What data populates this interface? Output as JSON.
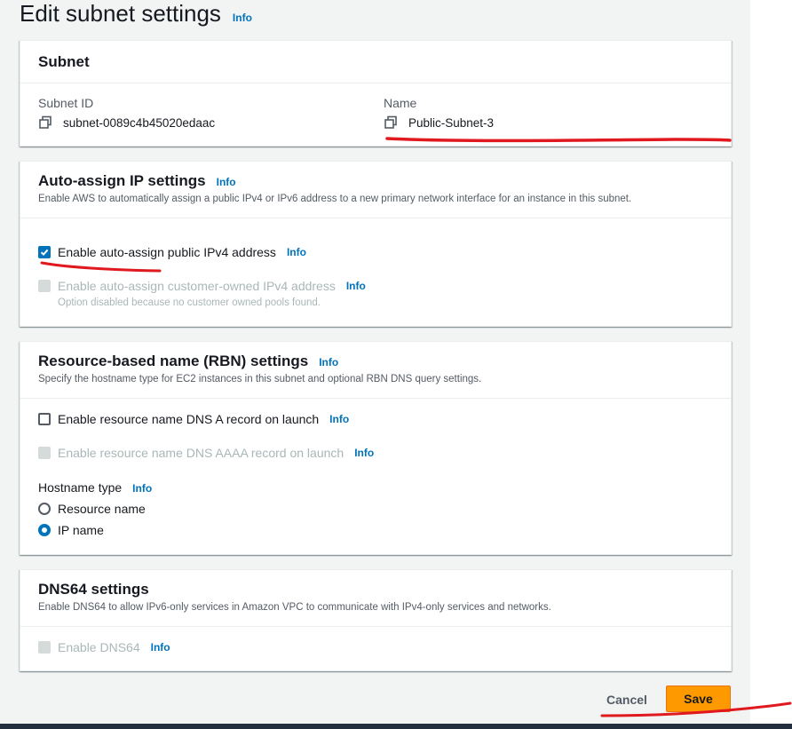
{
  "page": {
    "title": "Edit subnet settings",
    "info": "Info"
  },
  "subnet_panel": {
    "title": "Subnet",
    "subnet_id_label": "Subnet ID",
    "subnet_id_value": "subnet-0089c4b45020edaac",
    "name_label": "Name",
    "name_value": "Public-Subnet-3"
  },
  "auto_assign_panel": {
    "title": "Auto-assign IP settings",
    "info": "Info",
    "description": "Enable AWS to automatically assign a public IPv4 or IPv6 address to a new primary network interface for an instance in this subnet.",
    "ipv4_label": "Enable auto-assign public IPv4 address",
    "ipv4_checked": true,
    "ipv4_info": "Info",
    "customer_owned_label": "Enable auto-assign customer-owned IPv4 address",
    "customer_owned_info": "Info",
    "customer_owned_note": "Option disabled because no customer owned pools found."
  },
  "rbn_panel": {
    "title": "Resource-based name (RBN) settings",
    "info": "Info",
    "description": "Specify the hostname type for EC2 instances in this subnet and optional RBN DNS query settings.",
    "dns_a_label": "Enable resource name DNS A record on launch",
    "dns_a_info": "Info",
    "dns_aaaa_label": "Enable resource name DNS AAAA record on launch",
    "dns_aaaa_info": "Info",
    "hostname_type_label": "Hostname type",
    "hostname_type_info": "Info",
    "hostname_options": [
      "Resource name",
      "IP name"
    ],
    "hostname_selected": "IP name"
  },
  "dns64_panel": {
    "title": "DNS64 settings",
    "description": "Enable DNS64 to allow IPv6-only services in Amazon VPC to communicate with IPv4-only services and networks.",
    "enable_label": "Enable DNS64",
    "enable_info": "Info"
  },
  "footer": {
    "cancel_label": "Cancel",
    "save_label": "Save"
  },
  "colors": {
    "accent": "#0073bb",
    "primary_button": "#ff9900",
    "annotation": "#e0191f"
  }
}
